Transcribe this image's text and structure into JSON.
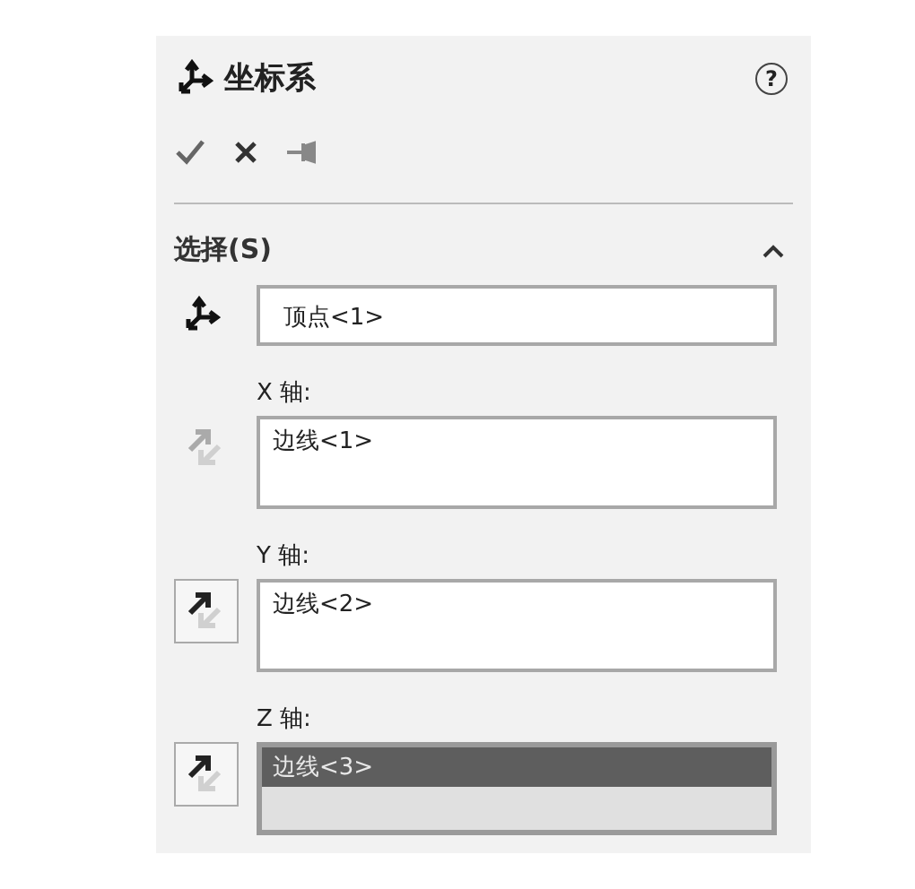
{
  "title": "坐标系",
  "help": "?",
  "section": {
    "title": "选择(S)",
    "expanded": true
  },
  "origin": {
    "value": "顶点<1>",
    "active": false
  },
  "axes": [
    {
      "label": "X 轴:",
      "value": "边线<1>",
      "reverse_enabled": false,
      "active": false
    },
    {
      "label": "Y 轴:",
      "value": "边线<2>",
      "reverse_enabled": true,
      "active": false
    },
    {
      "label": "Z 轴:",
      "value": "边线<3>",
      "reverse_enabled": true,
      "active": true
    }
  ]
}
